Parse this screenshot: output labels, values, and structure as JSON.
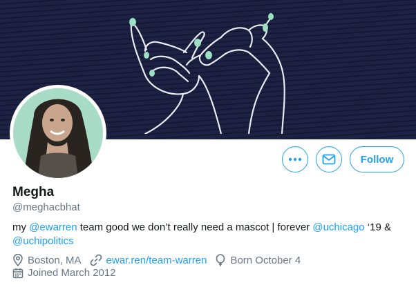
{
  "profile": {
    "name": "Megha",
    "handle": "@meghacbhat",
    "bio": [
      {
        "text": "my ",
        "link": false
      },
      {
        "text": "@ewarren",
        "link": true
      },
      {
        "text": " team good we don’t really need a mascot | forever ",
        "link": false
      },
      {
        "text": "@uchicago",
        "link": true
      },
      {
        "text": " ‘19 &",
        "link": false
      },
      {
        "text": "@uchipolitics",
        "link": true,
        "newline": true
      }
    ],
    "location": "Boston, MA",
    "website": "ewar.ren/team-warren",
    "birthday": "Born October 4",
    "joined": "Joined March 2012"
  },
  "actions": {
    "more_icon": "more-icon",
    "message_icon": "envelope-icon",
    "follow_label": "Follow"
  },
  "colors": {
    "accent": "#1da1f2",
    "banner": "#1d2245",
    "avatar_bg": "#a9dcc7",
    "nail_color": "#9ee0c4"
  }
}
